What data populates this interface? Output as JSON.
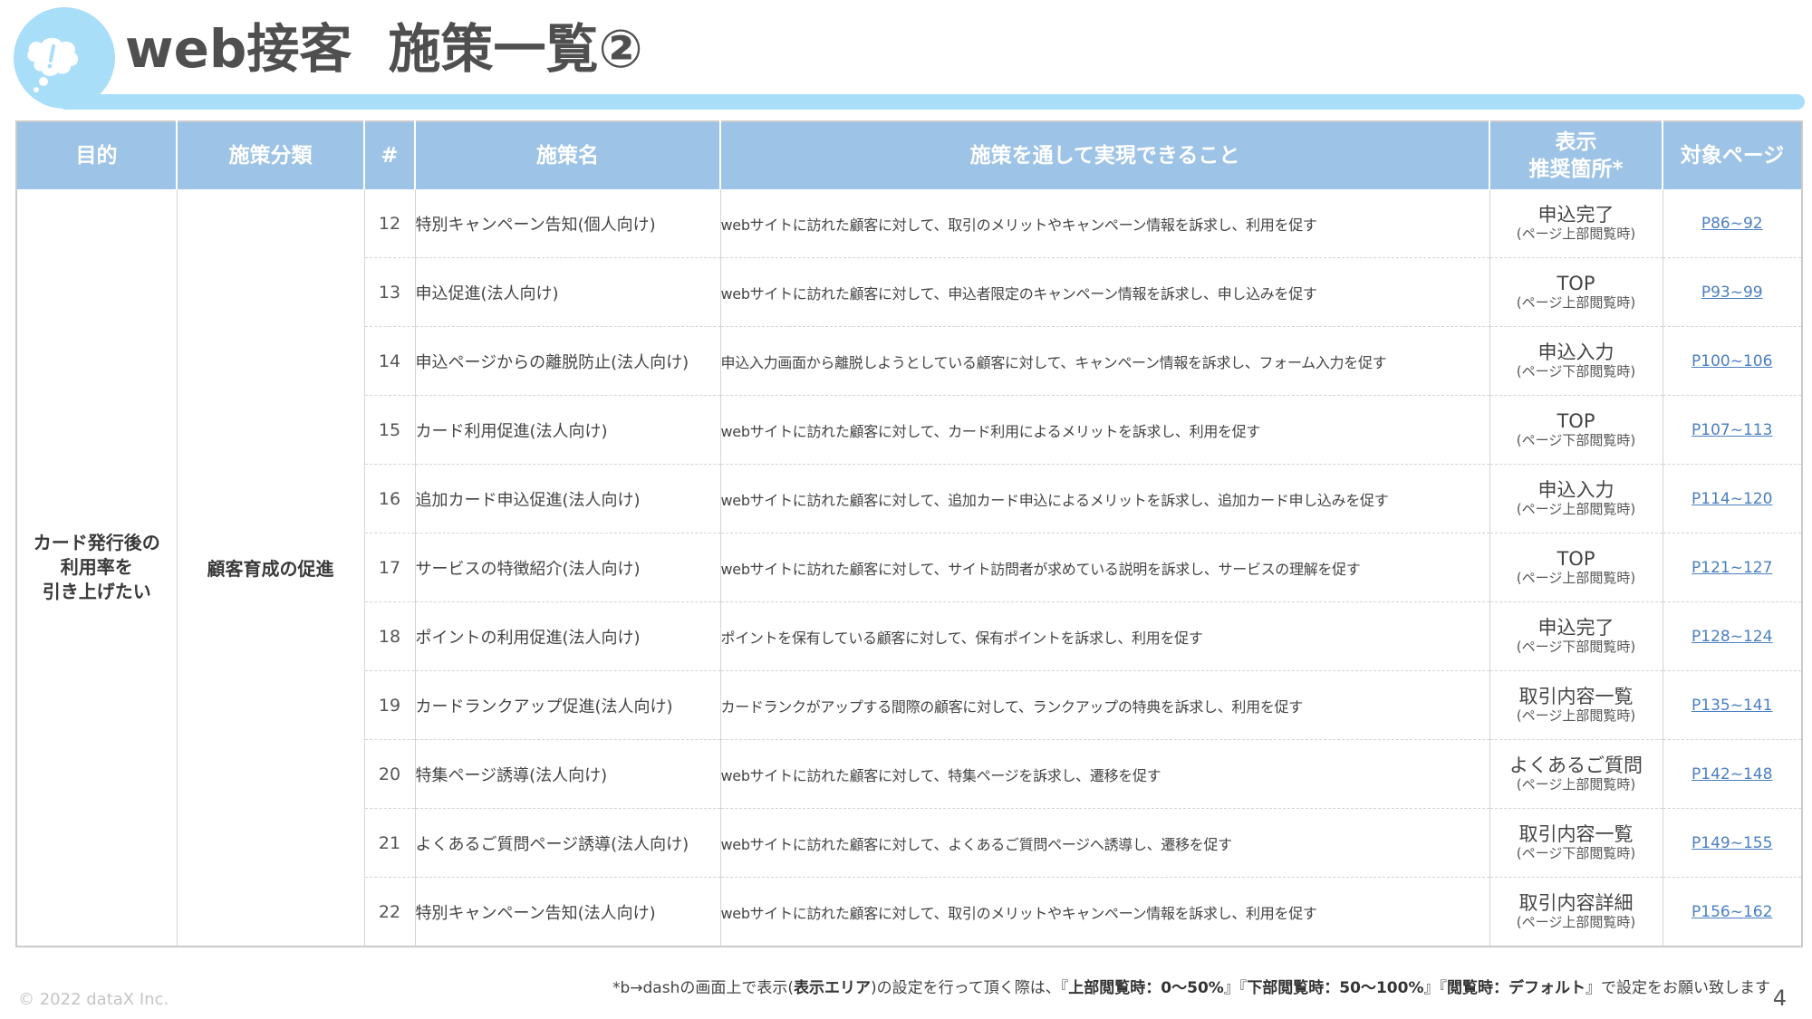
{
  "header": {
    "title_part1": "web接客",
    "title_part2": "施策一覧②",
    "logo_icon": "speech-bubble-exclamation-icon",
    "accent_color": "#a9def9"
  },
  "table": {
    "header_color": "#9dc3e6",
    "columns": {
      "purpose": "目的",
      "category": "施策分類",
      "num": "#",
      "name": "施策名",
      "description": "施策を通して実現できること",
      "placement_line1": "表示",
      "placement_line2": "推奨箇所*",
      "page": "対象ページ"
    },
    "purpose_lines": [
      "カード発行後の",
      "利用率を",
      "引き上げたい"
    ],
    "category": "顧客育成の促進",
    "rows": [
      {
        "num": "12",
        "name": "特別キャンペーン告知(個人向け)",
        "desc": "webサイトに訪れた顧客に対して、取引のメリットやキャンペーン情報を訴求し、利用を促す",
        "place": "申込完了",
        "place_sub": "(ページ上部閲覧時)",
        "page": "P86~92"
      },
      {
        "num": "13",
        "name": "申込促進(法人向け)",
        "desc": "webサイトに訪れた顧客に対して、申込者限定のキャンペーン情報を訴求し、申し込みを促す",
        "place": "TOP",
        "place_sub": "(ページ上部閲覧時)",
        "page": "P93~99"
      },
      {
        "num": "14",
        "name": "申込ページからの離脱防止(法人向け)",
        "desc": "申込入力画面から離脱しようとしている顧客に対して、キャンペーン情報を訴求し、フォーム入力を促す",
        "place": "申込入力",
        "place_sub": "(ページ下部閲覧時)",
        "page": "P100~106"
      },
      {
        "num": "15",
        "name": "カード利用促進(法人向け)",
        "desc": "webサイトに訪れた顧客に対して、カード利用によるメリットを訴求し、利用を促す",
        "place": "TOP",
        "place_sub": "(ページ下部閲覧時)",
        "page": "P107~113"
      },
      {
        "num": "16",
        "name": "追加カード申込促進(法人向け)",
        "desc": "webサイトに訪れた顧客に対して、追加カード申込によるメリットを訴求し、追加カード申し込みを促す",
        "place": "申込入力",
        "place_sub": "(ページ上部閲覧時)",
        "page": "P114~120"
      },
      {
        "num": "17",
        "name": "サービスの特徴紹介(法人向け)",
        "desc": "webサイトに訪れた顧客に対して、サイト訪問者が求めている説明を訴求し、サービスの理解を促す",
        "place": "TOP",
        "place_sub": "(ページ上部閲覧時)",
        "page": "P121~127"
      },
      {
        "num": "18",
        "name": "ポイントの利用促進(法人向け)",
        "desc": "ポイントを保有している顧客に対して、保有ポイントを訴求し、利用を促す",
        "place": "申込完了",
        "place_sub": "(ページ下部閲覧時)",
        "page": "P128~124"
      },
      {
        "num": "19",
        "name": "カードランクアップ促進(法人向け)",
        "desc": "カードランクがアップする間際の顧客に対して、ランクアップの特典を訴求し、利用を促す",
        "place": "取引内容一覧",
        "place_sub": "(ページ上部閲覧時)",
        "page": "P135~141"
      },
      {
        "num": "20",
        "name": "特集ページ誘導(法人向け)",
        "desc": "webサイトに訪れた顧客に対して、特集ページを訴求し、遷移を促す",
        "place": "よくあるご質問",
        "place_sub": "(ページ上部閲覧時)",
        "page": "P142~148"
      },
      {
        "num": "21",
        "name": "よくあるご質問ページ誘導(法人向け)",
        "desc": "webサイトに訪れた顧客に対して、よくあるご質問ページへ誘導し、遷移を促す",
        "place": "取引内容一覧",
        "place_sub": "(ページ下部閲覧時)",
        "page": "P149~155"
      },
      {
        "num": "22",
        "name": "特別キャンペーン告知(法人向け)",
        "desc": "webサイトに訪れた顧客に対して、取引のメリットやキャンペーン情報を訴求し、利用を促す",
        "place": "取引内容詳細",
        "place_sub": "(ページ上部閲覧時)",
        "page": "P156~162"
      }
    ]
  },
  "footnote": {
    "part1": "*b→dashの画面上で表示(",
    "bold1": "表示エリア",
    "part2": ")の設定を行って頂く際は、『",
    "bold2": "上部閲覧時：0～50%",
    "part3": "』『",
    "bold3": "下部閲覧時：50～100%",
    "part4": "』『",
    "bold4": "閲覧時：デフォルト",
    "part5": "』で設定をお願い致します"
  },
  "footer": {
    "copyright": "© 2022 dataX Inc.",
    "page_number": "4"
  }
}
